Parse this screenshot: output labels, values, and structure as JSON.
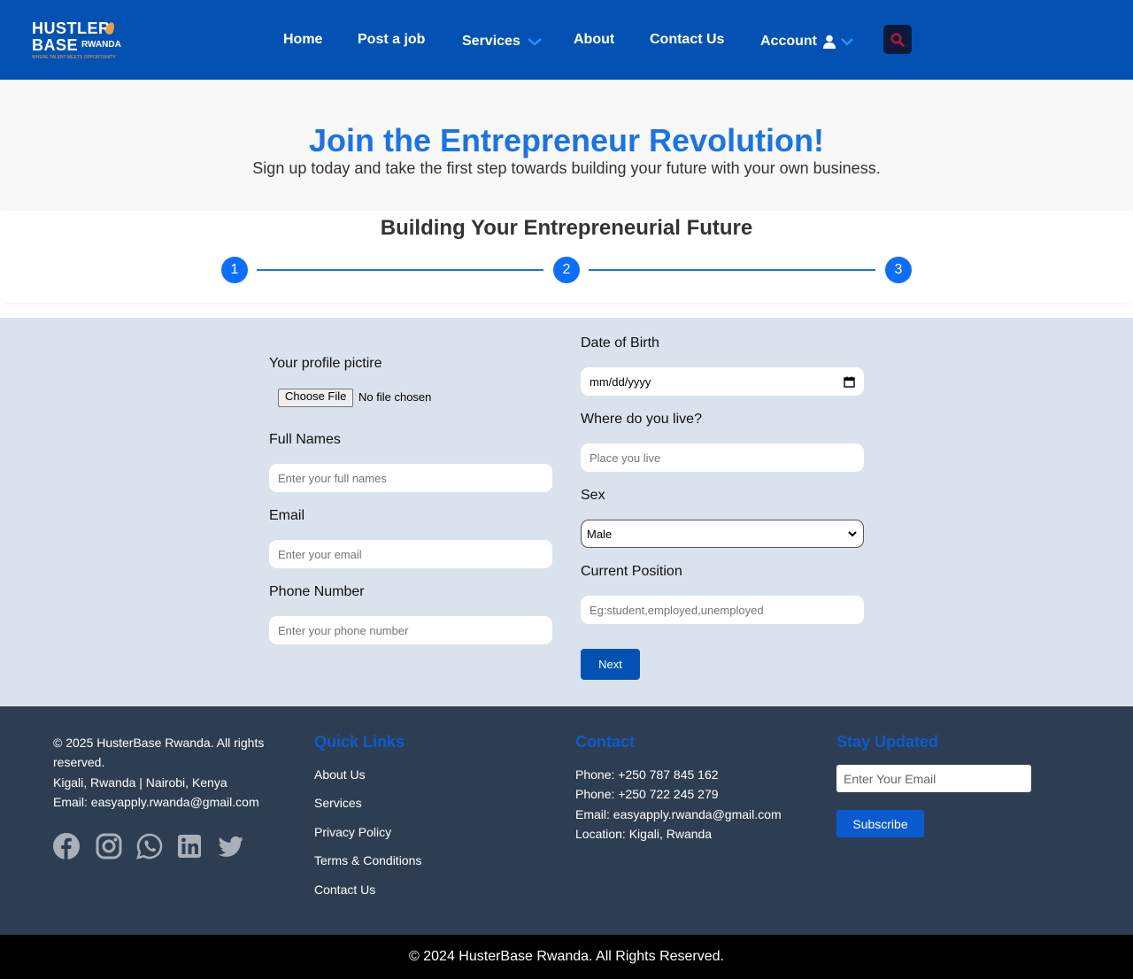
{
  "nav": {
    "logo": {
      "line1": "HUSTLER",
      "line2": "BASE",
      "line3": "RWANDA",
      "tagline": "WHERE TALENT MEETS OPPORTUNITY"
    },
    "home": "Home",
    "post_job": "Post a job",
    "services": "Services",
    "about": "About",
    "contact": "Contact Us",
    "account": "Account",
    "icons": {
      "services_dropdown": "chevron-down-icon",
      "account_user": "user-icon",
      "account_dropdown": "chevron-down-icon",
      "search": "search-icon"
    },
    "colors": {
      "background": "#0352b3",
      "chevron": "#2a8cff",
      "search_icon": "#c0143c"
    }
  },
  "hero": {
    "title": "Join the Entrepreneur Revolution!",
    "subtitle": "Sign up today and take the first step towards building your future with your own business.",
    "title_color": "#1a73e8"
  },
  "steps": {
    "heading": "Building Your Entrepreneurial Future",
    "items": [
      "1",
      "2",
      "3"
    ]
  },
  "form": {
    "profile_label": "Your profile pictire",
    "file_button": "Choose File",
    "file_status": "No file chosen",
    "full_names_label": "Full Names",
    "full_names_placeholder": "Enter your full names",
    "email_label": "Email",
    "email_placeholder": "Enter your email",
    "phone_label": "Phone Number",
    "phone_placeholder": "Enter your phone number",
    "dob_label": "Date of Birth",
    "dob_value": "mm/dd/yyyy",
    "live_label": "Where do you live?",
    "live_placeholder": "Place you live",
    "sex_label": "Sex",
    "sex_value": "Male",
    "position_label": "Current Position",
    "position_placeholder": "Eg:student,employed,unemployed",
    "next_button": "Next",
    "background": "#dae2ed"
  },
  "footer": {
    "copyright": "© 2025 HusterBase Rwanda. All rights reserved.",
    "location": "Kigali, Rwanda | Nairobi, Kenya",
    "email": "Email: easyapply.rwanda@gmail.com",
    "social_icons": [
      "facebook-icon",
      "instagram-icon",
      "whatsapp-icon",
      "linkedin-icon",
      "twitter-icon"
    ],
    "quick_links_title": "Quick Links",
    "quick_links": [
      "About Us",
      "Services",
      "Privacy Policy",
      "Terms & Conditions",
      "Contact Us"
    ],
    "contact_title": "Contact",
    "contact_lines": [
      "Phone: +250 787 845 162",
      "Phone: +250 722 245 279",
      "Email: easyapply.rwanda@gmail.com",
      "Location: Kigali, Rwanda"
    ],
    "newsletter_title": "Stay Updated",
    "newsletter_placeholder": "Enter Your Email",
    "subscribe_button": "Subscribe",
    "background": "#2e3e52",
    "heading_color": "#0a5bd0"
  },
  "bottom_bar": {
    "text": "© 2024 HusterBase Rwanda. All Rights Reserved."
  }
}
